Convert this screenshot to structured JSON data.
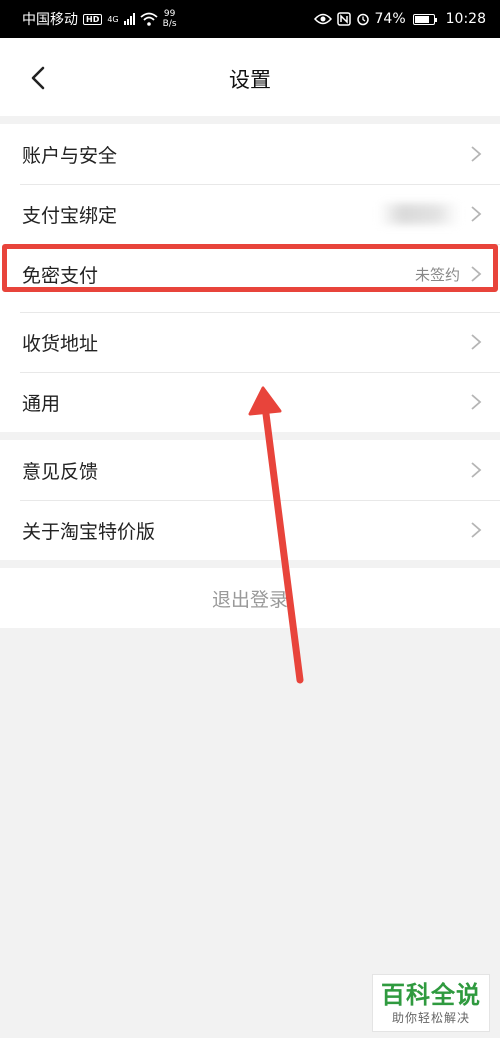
{
  "status_bar": {
    "carrier": "中国移动",
    "hd": "HD",
    "net": "4G",
    "speed_value": "99",
    "speed_unit": "B/s",
    "battery": "74%",
    "time": "10:28"
  },
  "nav": {
    "title": "设置",
    "back_icon": "chevron-left-icon"
  },
  "groups": [
    {
      "rows": [
        {
          "label": "账户与安全",
          "value": ""
        },
        {
          "label": "支付宝绑定",
          "value": "········"
        },
        {
          "label": "免密支付",
          "value": "未签约"
        },
        {
          "label": "收货地址",
          "value": ""
        },
        {
          "label": "通用",
          "value": ""
        }
      ]
    },
    {
      "rows": [
        {
          "label": "意见反馈",
          "value": ""
        },
        {
          "label": "关于淘宝特价版",
          "value": ""
        }
      ]
    }
  ],
  "logout": {
    "label": "退出登录"
  },
  "annotation": {
    "color": "#e8443b"
  },
  "watermark": {
    "title": "百科全说",
    "subtitle": "助你轻松解决"
  }
}
